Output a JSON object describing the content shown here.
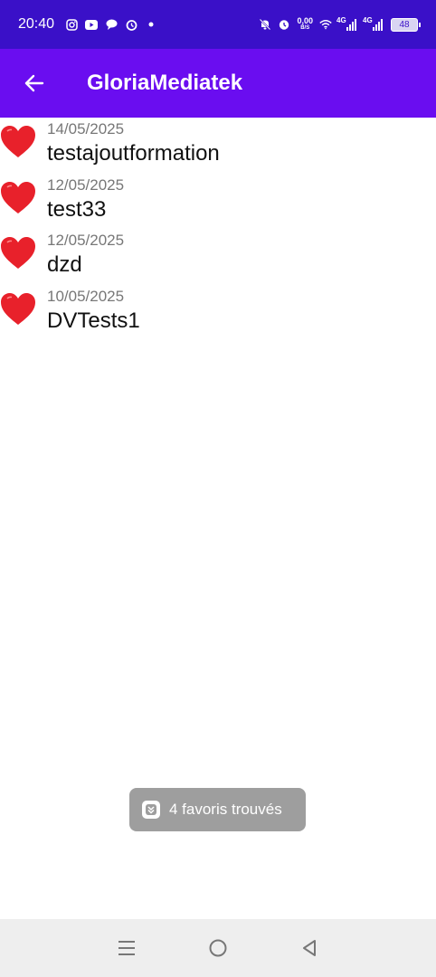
{
  "status_bar": {
    "time": "20:40",
    "net_speed_value": "0,00",
    "net_speed_unit": "B/S",
    "signal_1_label": "4G",
    "signal_2_label": "4G",
    "battery": "48",
    "icons": [
      "instagram-icon",
      "youtube-icon",
      "chat-icon",
      "alarm-icon",
      "dot-icon",
      "mute-bell-icon",
      "alarm-icon",
      "wifi-icon",
      "signal-icon",
      "signal-icon",
      "battery-icon"
    ]
  },
  "app_bar": {
    "title": "GloriaMediatek",
    "back_icon": "arrow-left-icon",
    "background": "#6a0df0"
  },
  "favorites": [
    {
      "date": "14/05/2025",
      "title": "testajoutformation",
      "icon": "heart-icon"
    },
    {
      "date": "12/05/2025",
      "title": "test33",
      "icon": "heart-icon"
    },
    {
      "date": "12/05/2025",
      "title": "dzd",
      "icon": "heart-icon"
    },
    {
      "date": "10/05/2025",
      "title": "DVTests1",
      "icon": "heart-icon"
    }
  ],
  "toast": {
    "text": "4 favoris trouvés"
  },
  "nav_bar": {
    "icons": [
      "menu-icon",
      "home-icon",
      "back-triangle-icon"
    ]
  },
  "colors": {
    "status_bar": "#3a10c8",
    "heart": "#e8212b",
    "toast": "#9e9e9e"
  }
}
